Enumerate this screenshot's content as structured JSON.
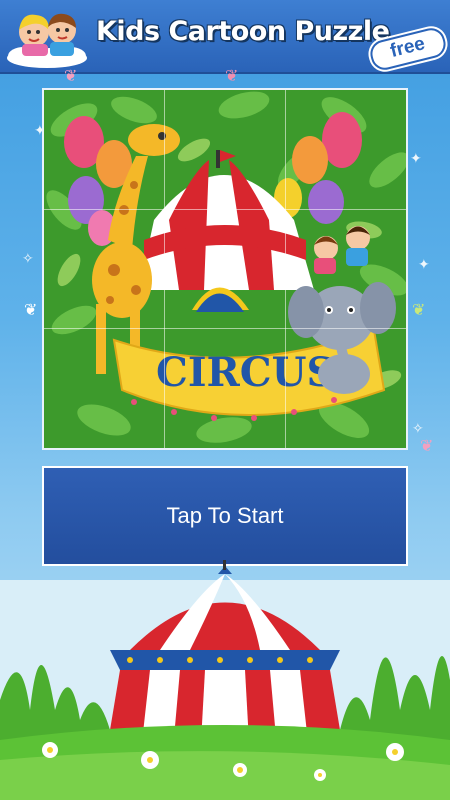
{
  "header": {
    "title": "Kids Cartoon Puzzle",
    "badge": "free",
    "logo_icon": "kids-on-cloud-icon"
  },
  "puzzle": {
    "sign_text": "CIRCUS",
    "image_icon": "circus-puzzle-image",
    "grid": {
      "rows": 3,
      "cols": 3
    }
  },
  "start_button": {
    "label": "Tap To Start"
  },
  "colors": {
    "header": "#2a63b8",
    "button": "#2b58aa",
    "sky": "#5fb2ea",
    "grass": "#3aa12a"
  }
}
